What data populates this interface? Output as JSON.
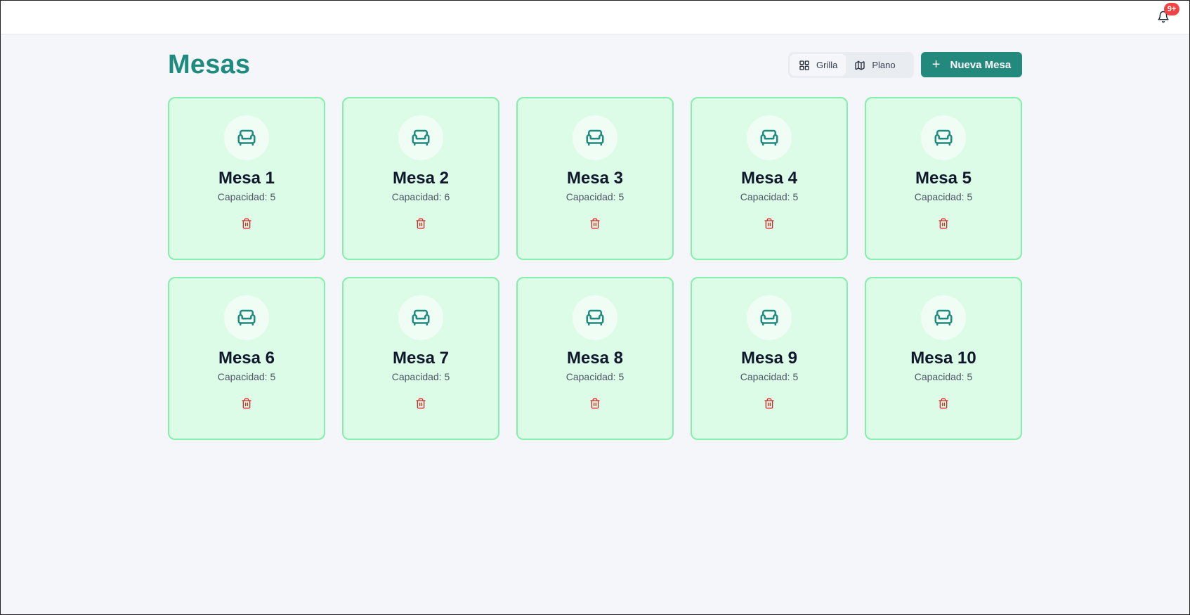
{
  "header": {
    "notifications_badge": "9+"
  },
  "page": {
    "title": "Mesas"
  },
  "view_toggle": {
    "grid_label": "Grilla",
    "plan_label": "Plano",
    "active": "Grilla"
  },
  "actions": {
    "new_table_label": "Nueva Mesa"
  },
  "colors": {
    "accent": "#23897d",
    "card_bg": "#dcfce7",
    "card_border": "#86efac",
    "delete": "#dc2626",
    "badge": "#ef4444"
  },
  "tables": [
    {
      "name": "Mesa 1",
      "capacity": "Capacidad: 5"
    },
    {
      "name": "Mesa 2",
      "capacity": "Capacidad: 6"
    },
    {
      "name": "Mesa 3",
      "capacity": "Capacidad: 5"
    },
    {
      "name": "Mesa 4",
      "capacity": "Capacidad: 5"
    },
    {
      "name": "Mesa 5",
      "capacity": "Capacidad: 5"
    },
    {
      "name": "Mesa 6",
      "capacity": "Capacidad: 5"
    },
    {
      "name": "Mesa 7",
      "capacity": "Capacidad: 5"
    },
    {
      "name": "Mesa 8",
      "capacity": "Capacidad: 5"
    },
    {
      "name": "Mesa 9",
      "capacity": "Capacidad: 5"
    },
    {
      "name": "Mesa 10",
      "capacity": "Capacidad: 5"
    }
  ]
}
